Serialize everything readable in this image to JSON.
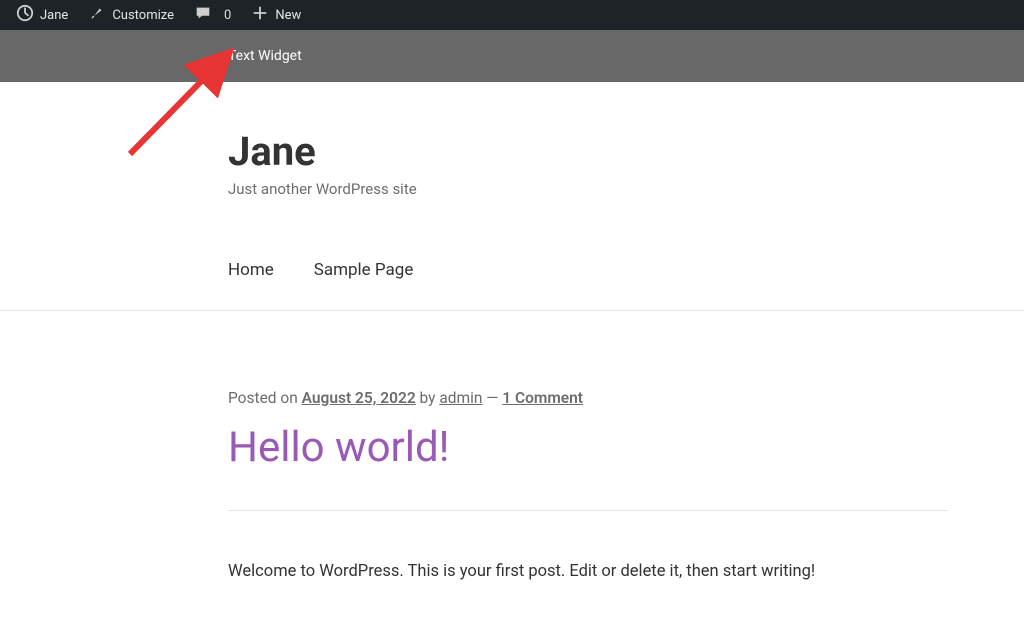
{
  "adminbar": {
    "site_name": "Jane",
    "customize": "Customize",
    "comments_count": "0",
    "new": "New"
  },
  "widgetbar": {
    "label": "Text Widget"
  },
  "header": {
    "site_title": "Jane",
    "tagline": "Just another WordPress site"
  },
  "nav": {
    "items": [
      {
        "label": "Home"
      },
      {
        "label": "Sample Page"
      }
    ]
  },
  "post": {
    "meta": {
      "posted_on_prefix": "Posted on ",
      "date": "August 25, 2022",
      "by_prefix": " by ",
      "author": "admin",
      "sep": " — ",
      "comments": "1 Comment"
    },
    "title": "Hello world!",
    "content": "Welcome to WordPress. This is your first post. Edit or delete it, then start writing!"
  },
  "colors": {
    "accent": "#9b59b6",
    "adminbar_bg": "#1d2327",
    "widgetbar_bg": "#686868",
    "arrow": "#e73535"
  }
}
